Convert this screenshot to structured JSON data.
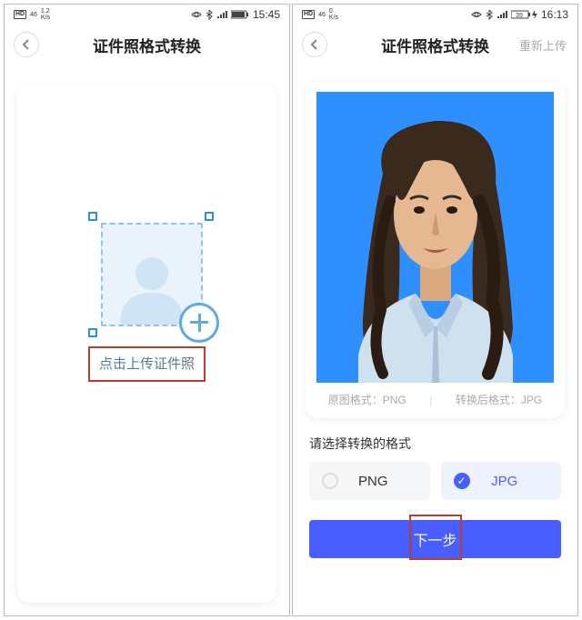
{
  "left": {
    "status": {
      "hd": "HD",
      "net": "46",
      "speed_top": "1.2",
      "speed_bot": "K/s",
      "time": "15:45"
    },
    "title": "证件照格式转换",
    "upload_label": "点击上传证件照"
  },
  "right": {
    "status": {
      "hd": "HD",
      "net": "46",
      "speed_top": "0",
      "speed_bot": "K/s",
      "battery": "39",
      "time": "16:13"
    },
    "title": "证件照格式转换",
    "reupload": "重新上传",
    "meta": {
      "src_label": "原图格式：",
      "src_value": "PNG",
      "dst_label": "转换后格式：",
      "dst_value": "JPG"
    },
    "section": "请选择转换的格式",
    "formats": {
      "png": "PNG",
      "jpg": "JPG"
    },
    "next": "下一步"
  }
}
